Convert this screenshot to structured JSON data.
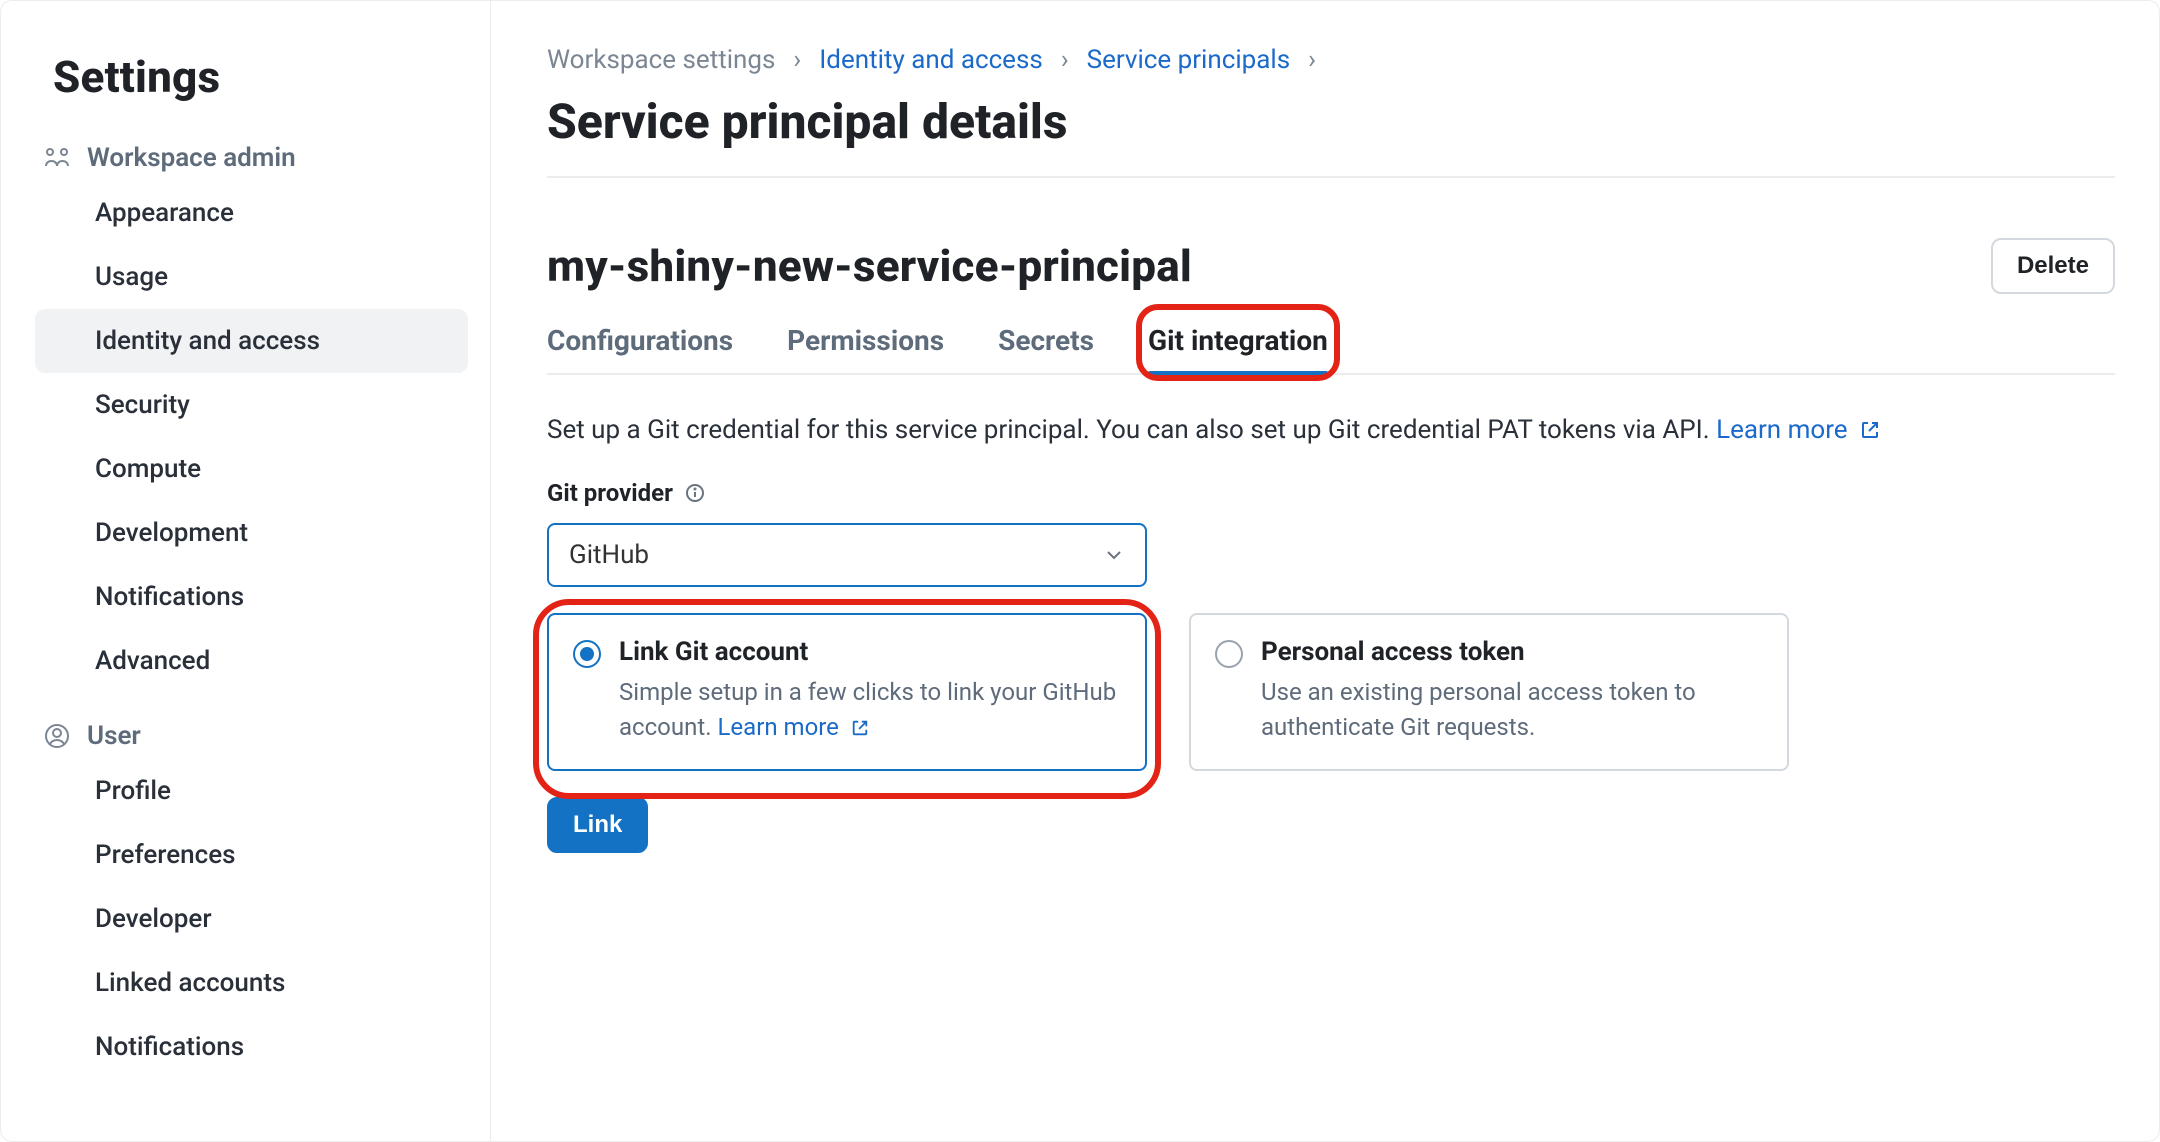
{
  "sidebar": {
    "title": "Settings",
    "sections": [
      {
        "label": "Workspace admin",
        "icon": "workspace-admin-icon",
        "items": [
          "Appearance",
          "Usage",
          "Identity and access",
          "Security",
          "Compute",
          "Development",
          "Notifications",
          "Advanced"
        ],
        "activeIndex": 2
      },
      {
        "label": "User",
        "icon": "user-icon",
        "items": [
          "Profile",
          "Preferences",
          "Developer",
          "Linked accounts",
          "Notifications"
        ],
        "activeIndex": -1
      }
    ]
  },
  "breadcrumb": {
    "items": [
      "Workspace settings",
      "Identity and access",
      "Service principals"
    ]
  },
  "header": {
    "pageTitle": "Service principal details",
    "principalName": "my-shiny-new-service-principal",
    "deleteLabel": "Delete"
  },
  "tabs": {
    "items": [
      "Configurations",
      "Permissions",
      "Secrets",
      "Git integration"
    ],
    "activeIndex": 3
  },
  "git": {
    "description_prefix": "Set up a Git credential for this service principal. You can also set up Git credential PAT tokens via API. ",
    "learnMoreLabel": "Learn more",
    "providerLabel": "Git provider",
    "providerSelected": "GitHub",
    "options": [
      {
        "title": "Link Git account",
        "body_prefix": "Simple setup in a few clicks to link your GitHub account. ",
        "learnMoreLabel": "Learn more",
        "selected": true
      },
      {
        "title": "Personal access token",
        "body": "Use an existing personal access token to authenticate Git requests.",
        "selected": false
      }
    ],
    "linkButtonLabel": "Link"
  },
  "colors": {
    "accent": "#1472c4",
    "highlight": "#e22315"
  }
}
